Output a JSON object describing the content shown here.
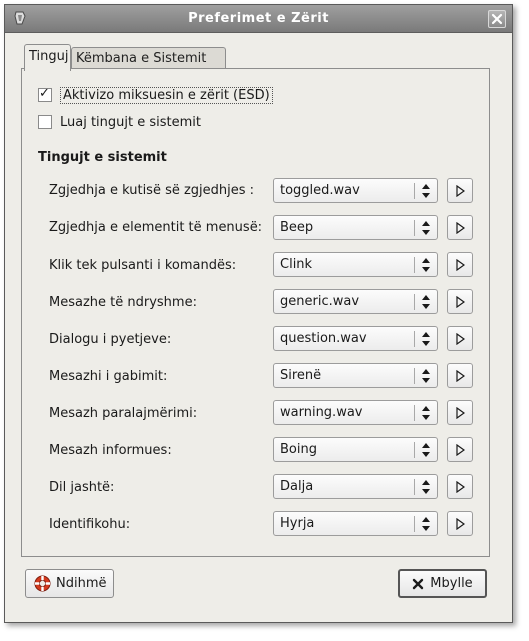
{
  "window": {
    "title": "Preferimet e Zërit"
  },
  "tabs": [
    {
      "label": "Tinguj",
      "active": true
    },
    {
      "label": "Këmbana e Sistemit",
      "active": false
    }
  ],
  "options": {
    "enable_mixer": {
      "label": "Aktivizo miksuesin e zërit (ESD)",
      "checked": true
    },
    "play_system_sounds": {
      "label": "Luaj tingujt e sistemit",
      "checked": false
    }
  },
  "section_title": "Tingujt e sistemit",
  "sounds": [
    {
      "label": "Zgjedhja e kutisë së zgjedhjes :",
      "value": "toggled.wav"
    },
    {
      "label": "Zgjedhja e elementit të menusë:",
      "value": "Beep"
    },
    {
      "label": "Klik tek pulsanti i komandës:",
      "value": "Clink"
    },
    {
      "label": "Mesazhe të ndryshme:",
      "value": "generic.wav"
    },
    {
      "label": "Dialogu i pyetjeve:",
      "value": "question.wav"
    },
    {
      "label": "Mesazhi i gabimit:",
      "value": "Sirenë"
    },
    {
      "label": "Mesazh paralajmërimi:",
      "value": "warning.wav"
    },
    {
      "label": "Mesazh informues:",
      "value": "Boing"
    },
    {
      "label": "Dil jashtë:",
      "value": "Dalja"
    },
    {
      "label": "Identifikohu:",
      "value": "Hyrja"
    }
  ],
  "buttons": {
    "help": "Ndihmë",
    "close": "Mbylle"
  },
  "icons": {
    "window_menu": "window-menu-icon",
    "close": "close-icon",
    "play": "play-icon",
    "combo_arrows": "updown-arrows-icon",
    "help": "lifebuoy-icon",
    "close_button": "x-icon"
  }
}
